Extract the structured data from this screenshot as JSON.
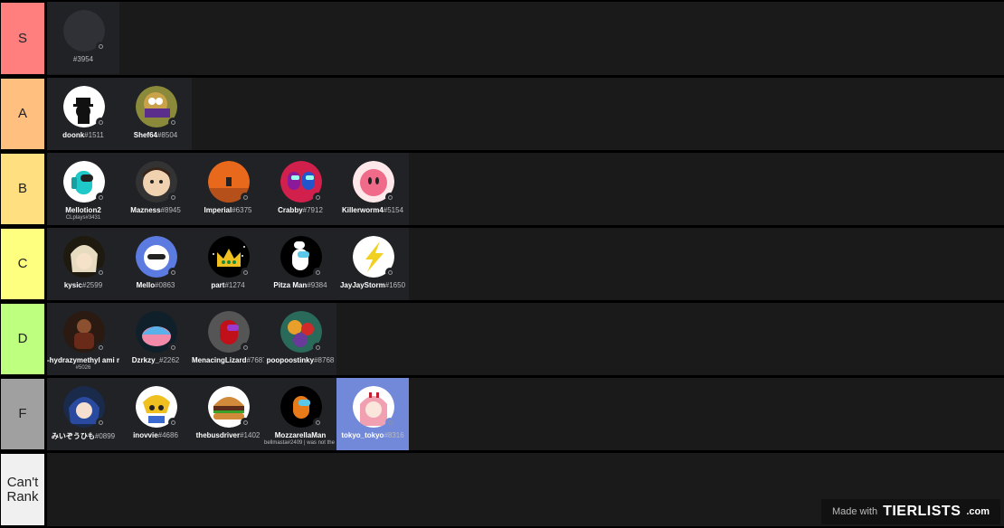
{
  "tiers": [
    {
      "label": "S",
      "color": "#ff7f7f",
      "items": [
        {
          "name": "",
          "tag": "#3954",
          "sub": "",
          "avatar": "blank"
        }
      ]
    },
    {
      "label": "A",
      "color": "#ffbf7f",
      "items": [
        {
          "name": "doonk",
          "tag": "#1511",
          "sub": "",
          "avatar": "white-silhouette"
        },
        {
          "name": "Shef64",
          "tag": "#8504",
          "sub": "",
          "avatar": "cartoon-face"
        }
      ]
    },
    {
      "label": "B",
      "color": "#ffdf7f",
      "items": [
        {
          "name": "Mellotion2",
          "tag": "",
          "sub": "CLplays#3431",
          "avatar": "cyan-crewmate"
        },
        {
          "name": "Mazness",
          "tag": "#8945",
          "sub": "",
          "avatar": "cartoon-boy"
        },
        {
          "name": "Imperial",
          "tag": "#6375",
          "sub": "",
          "avatar": "orange-scene"
        },
        {
          "name": "Crabby",
          "tag": "#7912",
          "sub": "",
          "avatar": "red-crewmates"
        },
        {
          "name": "Killerworm4",
          "tag": "#5154",
          "sub": "",
          "avatar": "kirby"
        }
      ]
    },
    {
      "label": "C",
      "color": "#ffff7f",
      "items": [
        {
          "name": "kysic",
          "tag": "#2599",
          "sub": "",
          "avatar": "anime-dark"
        },
        {
          "name": "Mello",
          "tag": "#0863",
          "sub": "",
          "avatar": "blue-face"
        },
        {
          "name": "part",
          "tag": "#1274",
          "sub": "",
          "avatar": "crown"
        },
        {
          "name": "Pitza Man",
          "tag": "#9384",
          "sub": "",
          "avatar": "chef-crewmate"
        },
        {
          "name": "JayJayStorm",
          "tag": "#1650",
          "sub": "",
          "avatar": "lightning"
        }
      ]
    },
    {
      "label": "D",
      "color": "#bfff7f",
      "items": [
        {
          "name": "-hydrazymethyl ami methane",
          "tag": "",
          "sub": "#5026",
          "avatar": "brown-figure"
        },
        {
          "name": "Dzrkzy_",
          "tag": "#2262",
          "sub": "",
          "avatar": "sleeping-kirby"
        },
        {
          "name": "MenacingLizard",
          "tag": "#7687",
          "sub": "",
          "avatar": "red-crewmate"
        },
        {
          "name": "poopoostinky",
          "tag": "#8768",
          "sub": "",
          "avatar": "colorful-art"
        }
      ]
    },
    {
      "label": "F",
      "color": "#a0a0a0",
      "items": [
        {
          "name": "みいぞうひも",
          "tag": "#0899",
          "sub": "",
          "avatar": "anime-blue"
        },
        {
          "name": "inovvie",
          "tag": "#4686",
          "sub": "",
          "avatar": "pop-team"
        },
        {
          "name": "thebusdriver",
          "tag": "#1402",
          "sub": "",
          "avatar": "burger"
        },
        {
          "name": "MozzarellaMan",
          "tag": "",
          "sub": "bellmasta#2409 | was not the impostor",
          "avatar": "orange-crewmate"
        },
        {
          "name": "tokyo_tokyo",
          "tag": "#8316",
          "sub": "",
          "avatar": "anime-pink",
          "highlight": true
        }
      ]
    },
    {
      "label": "Can't Rank",
      "color": "#f0f0f0",
      "items": []
    }
  ],
  "watermark": {
    "made_with": "Made with",
    "logo": "TIERLISTS",
    "suffix": ".com"
  }
}
